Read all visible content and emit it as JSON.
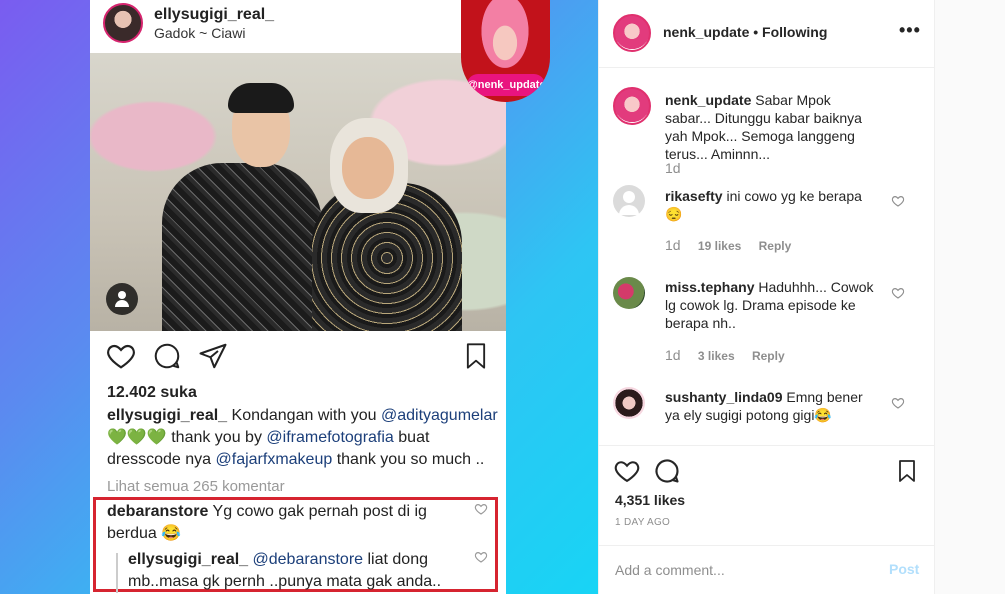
{
  "post_image": {
    "account": "ellysugigi_real_",
    "location": "Gadok ~ Ciawi",
    "badge_label": "@nenk_update",
    "likes": "12.402 suka",
    "caption": {
      "user": "ellysugigi_real_",
      "text1": "Kondangan with you",
      "mention1": "@adityagumelar",
      "emoji": "💚💚💚",
      "text2": "thank you by",
      "mention2": "@iframefotografia",
      "text3": "buat dresscode nya",
      "mention3": "@fajarfxmakeup",
      "text4": "thank you so much .."
    },
    "view_all": "Lihat semua 265 komentar",
    "comment1": {
      "user": "debaranstore",
      "text": "Yg cowo gak pernah post di ig berdua 😂"
    },
    "comment2": {
      "user": "ellysugigi_real_",
      "mention": "@debaranstore",
      "text": "liat dong mb..masa gk pernh ..punya mata gak anda.."
    }
  },
  "panel": {
    "header": {
      "user": "nenk_update",
      "separator": " • ",
      "follow_state": "Following",
      "more": "•••"
    },
    "caption": {
      "user": "nenk_update",
      "text": "Sabar Mpok sabar... Ditunggu kabar baiknya yah Mpok... Semoga langgeng terus... Aminnn...",
      "time": "1d"
    },
    "comments": [
      {
        "user": "rikasefty",
        "text": "ini cowo yg ke berapa 😔",
        "time": "1d",
        "likes": "19 likes",
        "reply": "Reply"
      },
      {
        "user": "miss.tephany",
        "text": "Haduhhh... Cowok lg cowok lg. Drama episode ke berapa nh..",
        "time": "1d",
        "likes": "3 likes",
        "reply": "Reply"
      },
      {
        "user": "sushanty_linda09",
        "text": "Emng bener ya ely sugigi potong gigi😂"
      }
    ],
    "likes": "4,351 likes",
    "ago": "1 DAY AGO",
    "add_comment": {
      "placeholder": "Add a comment...",
      "post_label": "Post"
    }
  }
}
